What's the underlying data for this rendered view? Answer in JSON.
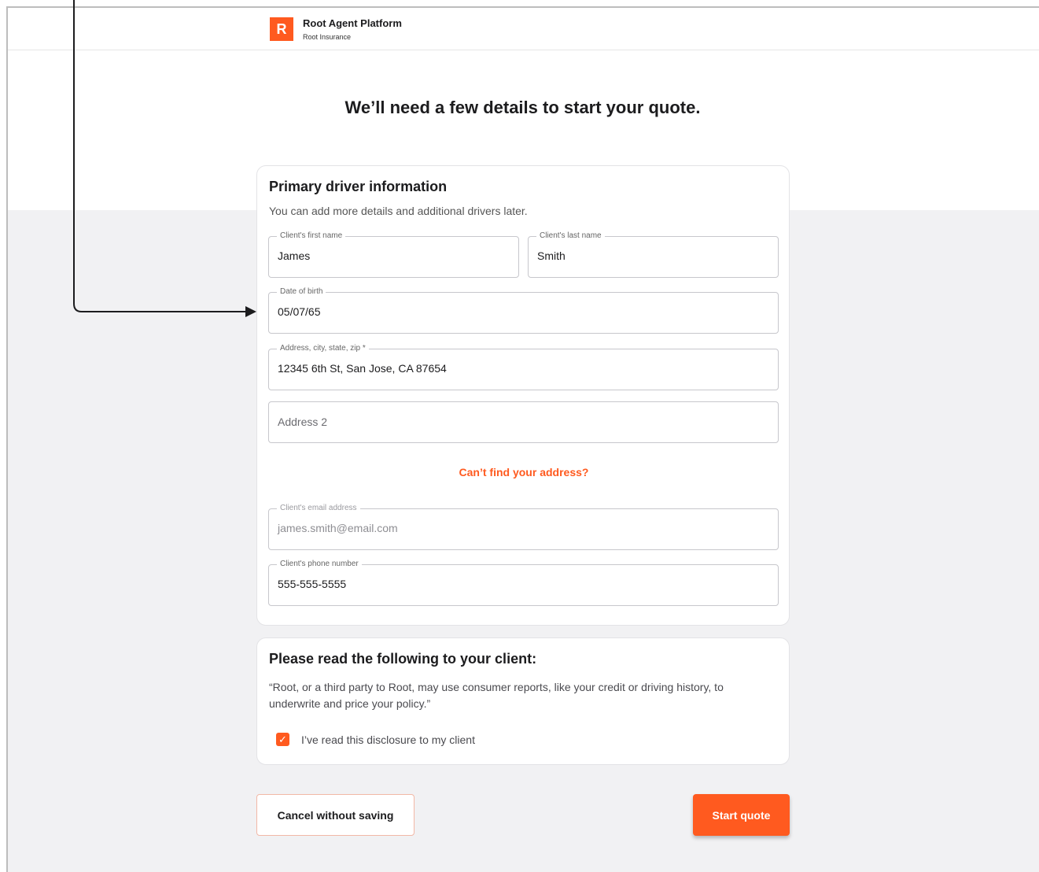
{
  "header": {
    "logo_letter": "R",
    "app_title": "Root Agent Platform",
    "company": "Root Insurance"
  },
  "page": {
    "title": "We’ll need a few details to start your quote."
  },
  "driver_card": {
    "title": "Primary driver information",
    "subtitle": "You can add more details and additional drivers later.",
    "first_name": {
      "label": "Client's first name",
      "value": "James"
    },
    "last_name": {
      "label": "Client's last name",
      "value": "Smith"
    },
    "dob": {
      "label": "Date of birth",
      "value": "05/07/65"
    },
    "address": {
      "label": "Address, city, state, zip *",
      "value": "12345 6th St, San Jose, CA 87654"
    },
    "address2": {
      "placeholder": "Address 2"
    },
    "cant_find_link": "Can’t find your address?",
    "email": {
      "label": "Client's email address",
      "value": "james.smith@email.com"
    },
    "phone": {
      "label": "Client's phone number",
      "value": "555-555-5555"
    }
  },
  "disclosure_card": {
    "title": "Please read the following to your client:",
    "text": "“Root, or a third party to Root, may use consumer reports, like your credit or driving history, to underwrite and price your policy.”",
    "checkbox_label": "I’ve read this disclosure to my client",
    "checkbox_checked": true
  },
  "actions": {
    "cancel_label": "Cancel without saving",
    "start_label": "Start quote"
  },
  "colors": {
    "accent": "#ff5a1f",
    "background_gray": "#f1f1f3"
  }
}
